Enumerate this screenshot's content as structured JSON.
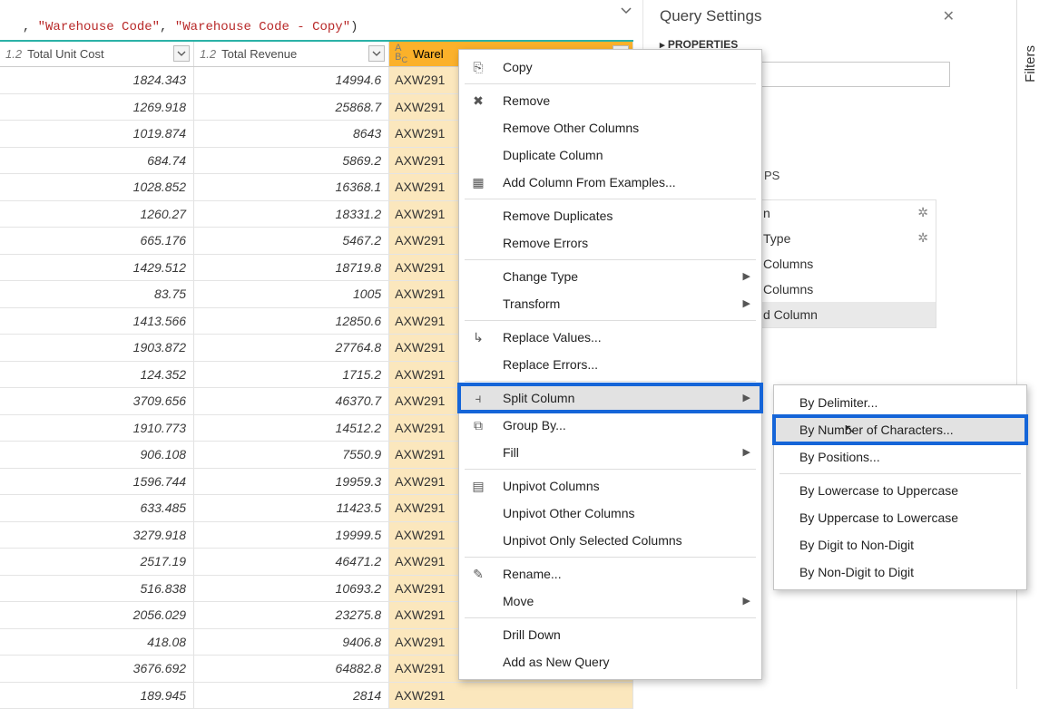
{
  "formula_bar": {
    "prefix": ", ",
    "q1": "\"Warehouse Code\"",
    "mid": ", ",
    "q2": "\"Warehouse Code - Copy\"",
    "suffix": ")"
  },
  "columns": {
    "c1": {
      "type": "1.2",
      "label": "Total Unit Cost"
    },
    "c2": {
      "type": "1.2",
      "label": "Total Revenue"
    },
    "c3": {
      "type": "ABC",
      "label": "Warel"
    }
  },
  "chart_data": {
    "type": "table",
    "columns": [
      "Total Unit Cost",
      "Total Revenue",
      "Warehouse Code"
    ],
    "rows": [
      {
        "total_unit_cost": "1824.343",
        "total_revenue": "14994.6",
        "wh": "AXW291"
      },
      {
        "total_unit_cost": "1269.918",
        "total_revenue": "25868.7",
        "wh": "AXW291"
      },
      {
        "total_unit_cost": "1019.874",
        "total_revenue": "8643",
        "wh": "AXW291"
      },
      {
        "total_unit_cost": "684.74",
        "total_revenue": "5869.2",
        "wh": "AXW291"
      },
      {
        "total_unit_cost": "1028.852",
        "total_revenue": "16368.1",
        "wh": "AXW291"
      },
      {
        "total_unit_cost": "1260.27",
        "total_revenue": "18331.2",
        "wh": "AXW291"
      },
      {
        "total_unit_cost": "665.176",
        "total_revenue": "5467.2",
        "wh": "AXW291"
      },
      {
        "total_unit_cost": "1429.512",
        "total_revenue": "18719.8",
        "wh": "AXW291"
      },
      {
        "total_unit_cost": "83.75",
        "total_revenue": "1005",
        "wh": "AXW291"
      },
      {
        "total_unit_cost": "1413.566",
        "total_revenue": "12850.6",
        "wh": "AXW291"
      },
      {
        "total_unit_cost": "1903.872",
        "total_revenue": "27764.8",
        "wh": "AXW291"
      },
      {
        "total_unit_cost": "124.352",
        "total_revenue": "1715.2",
        "wh": "AXW291"
      },
      {
        "total_unit_cost": "3709.656",
        "total_revenue": "46370.7",
        "wh": "AXW291"
      },
      {
        "total_unit_cost": "1910.773",
        "total_revenue": "14512.2",
        "wh": "AXW291"
      },
      {
        "total_unit_cost": "906.108",
        "total_revenue": "7550.9",
        "wh": "AXW291"
      },
      {
        "total_unit_cost": "1596.744",
        "total_revenue": "19959.3",
        "wh": "AXW291"
      },
      {
        "total_unit_cost": "633.485",
        "total_revenue": "11423.5",
        "wh": "AXW291"
      },
      {
        "total_unit_cost": "3279.918",
        "total_revenue": "19999.5",
        "wh": "AXW291"
      },
      {
        "total_unit_cost": "2517.19",
        "total_revenue": "46471.2",
        "wh": "AXW291"
      },
      {
        "total_unit_cost": "516.838",
        "total_revenue": "10693.2",
        "wh": "AXW291"
      },
      {
        "total_unit_cost": "2056.029",
        "total_revenue": "23275.8",
        "wh": "AXW291"
      },
      {
        "total_unit_cost": "418.08",
        "total_revenue": "9406.8",
        "wh": "AXW291"
      },
      {
        "total_unit_cost": "3676.692",
        "total_revenue": "64882.8",
        "wh": "AXW291"
      },
      {
        "total_unit_cost": "189.945",
        "total_revenue": "2814",
        "wh": "AXW291"
      }
    ]
  },
  "query_settings": {
    "title": "Query Settings",
    "properties_label": "PROPERTIES",
    "steps_label_suffix": "PS",
    "steps": [
      {
        "label": "n",
        "gear": true
      },
      {
        "label": "Type",
        "gear": true
      },
      {
        "label": "Columns"
      },
      {
        "label": "Columns"
      },
      {
        "label": "d Column",
        "selected": true
      }
    ]
  },
  "filters_tab": "Filters",
  "context_menu": {
    "items": [
      {
        "icon": "copy",
        "label": "Copy"
      },
      {
        "sep": true
      },
      {
        "icon": "remove",
        "label": "Remove"
      },
      {
        "label": "Remove Other Columns"
      },
      {
        "label": "Duplicate Column"
      },
      {
        "icon": "example",
        "label": "Add Column From Examples..."
      },
      {
        "sep": true
      },
      {
        "label": "Remove Duplicates"
      },
      {
        "label": "Remove Errors"
      },
      {
        "sep": true
      },
      {
        "label": "Change Type",
        "sub": true
      },
      {
        "label": "Transform",
        "sub": true
      },
      {
        "sep": true
      },
      {
        "icon": "replace",
        "label": "Replace Values..."
      },
      {
        "label": "Replace Errors..."
      },
      {
        "sep": true
      },
      {
        "icon": "split",
        "label": "Split Column",
        "sub": true,
        "hover": true,
        "highlight": true
      },
      {
        "icon": "group",
        "label": "Group By..."
      },
      {
        "label": "Fill",
        "sub": true
      },
      {
        "sep": true
      },
      {
        "icon": "unpivot",
        "label": "Unpivot Columns"
      },
      {
        "label": "Unpivot Other Columns"
      },
      {
        "label": "Unpivot Only Selected Columns"
      },
      {
        "sep": true
      },
      {
        "icon": "rename",
        "label": "Rename..."
      },
      {
        "label": "Move",
        "sub": true
      },
      {
        "sep": true
      },
      {
        "label": "Drill Down"
      },
      {
        "label": "Add as New Query"
      }
    ]
  },
  "submenu": {
    "items": [
      {
        "label": "By Delimiter..."
      },
      {
        "label": "By Number of Characters...",
        "hover": true,
        "highlight": true
      },
      {
        "label": "By Positions..."
      },
      {
        "sep": true
      },
      {
        "label": "By Lowercase to Uppercase"
      },
      {
        "label": "By Uppercase to Lowercase"
      },
      {
        "label": "By Digit to Non-Digit"
      },
      {
        "label": "By Non-Digit to Digit"
      }
    ]
  }
}
